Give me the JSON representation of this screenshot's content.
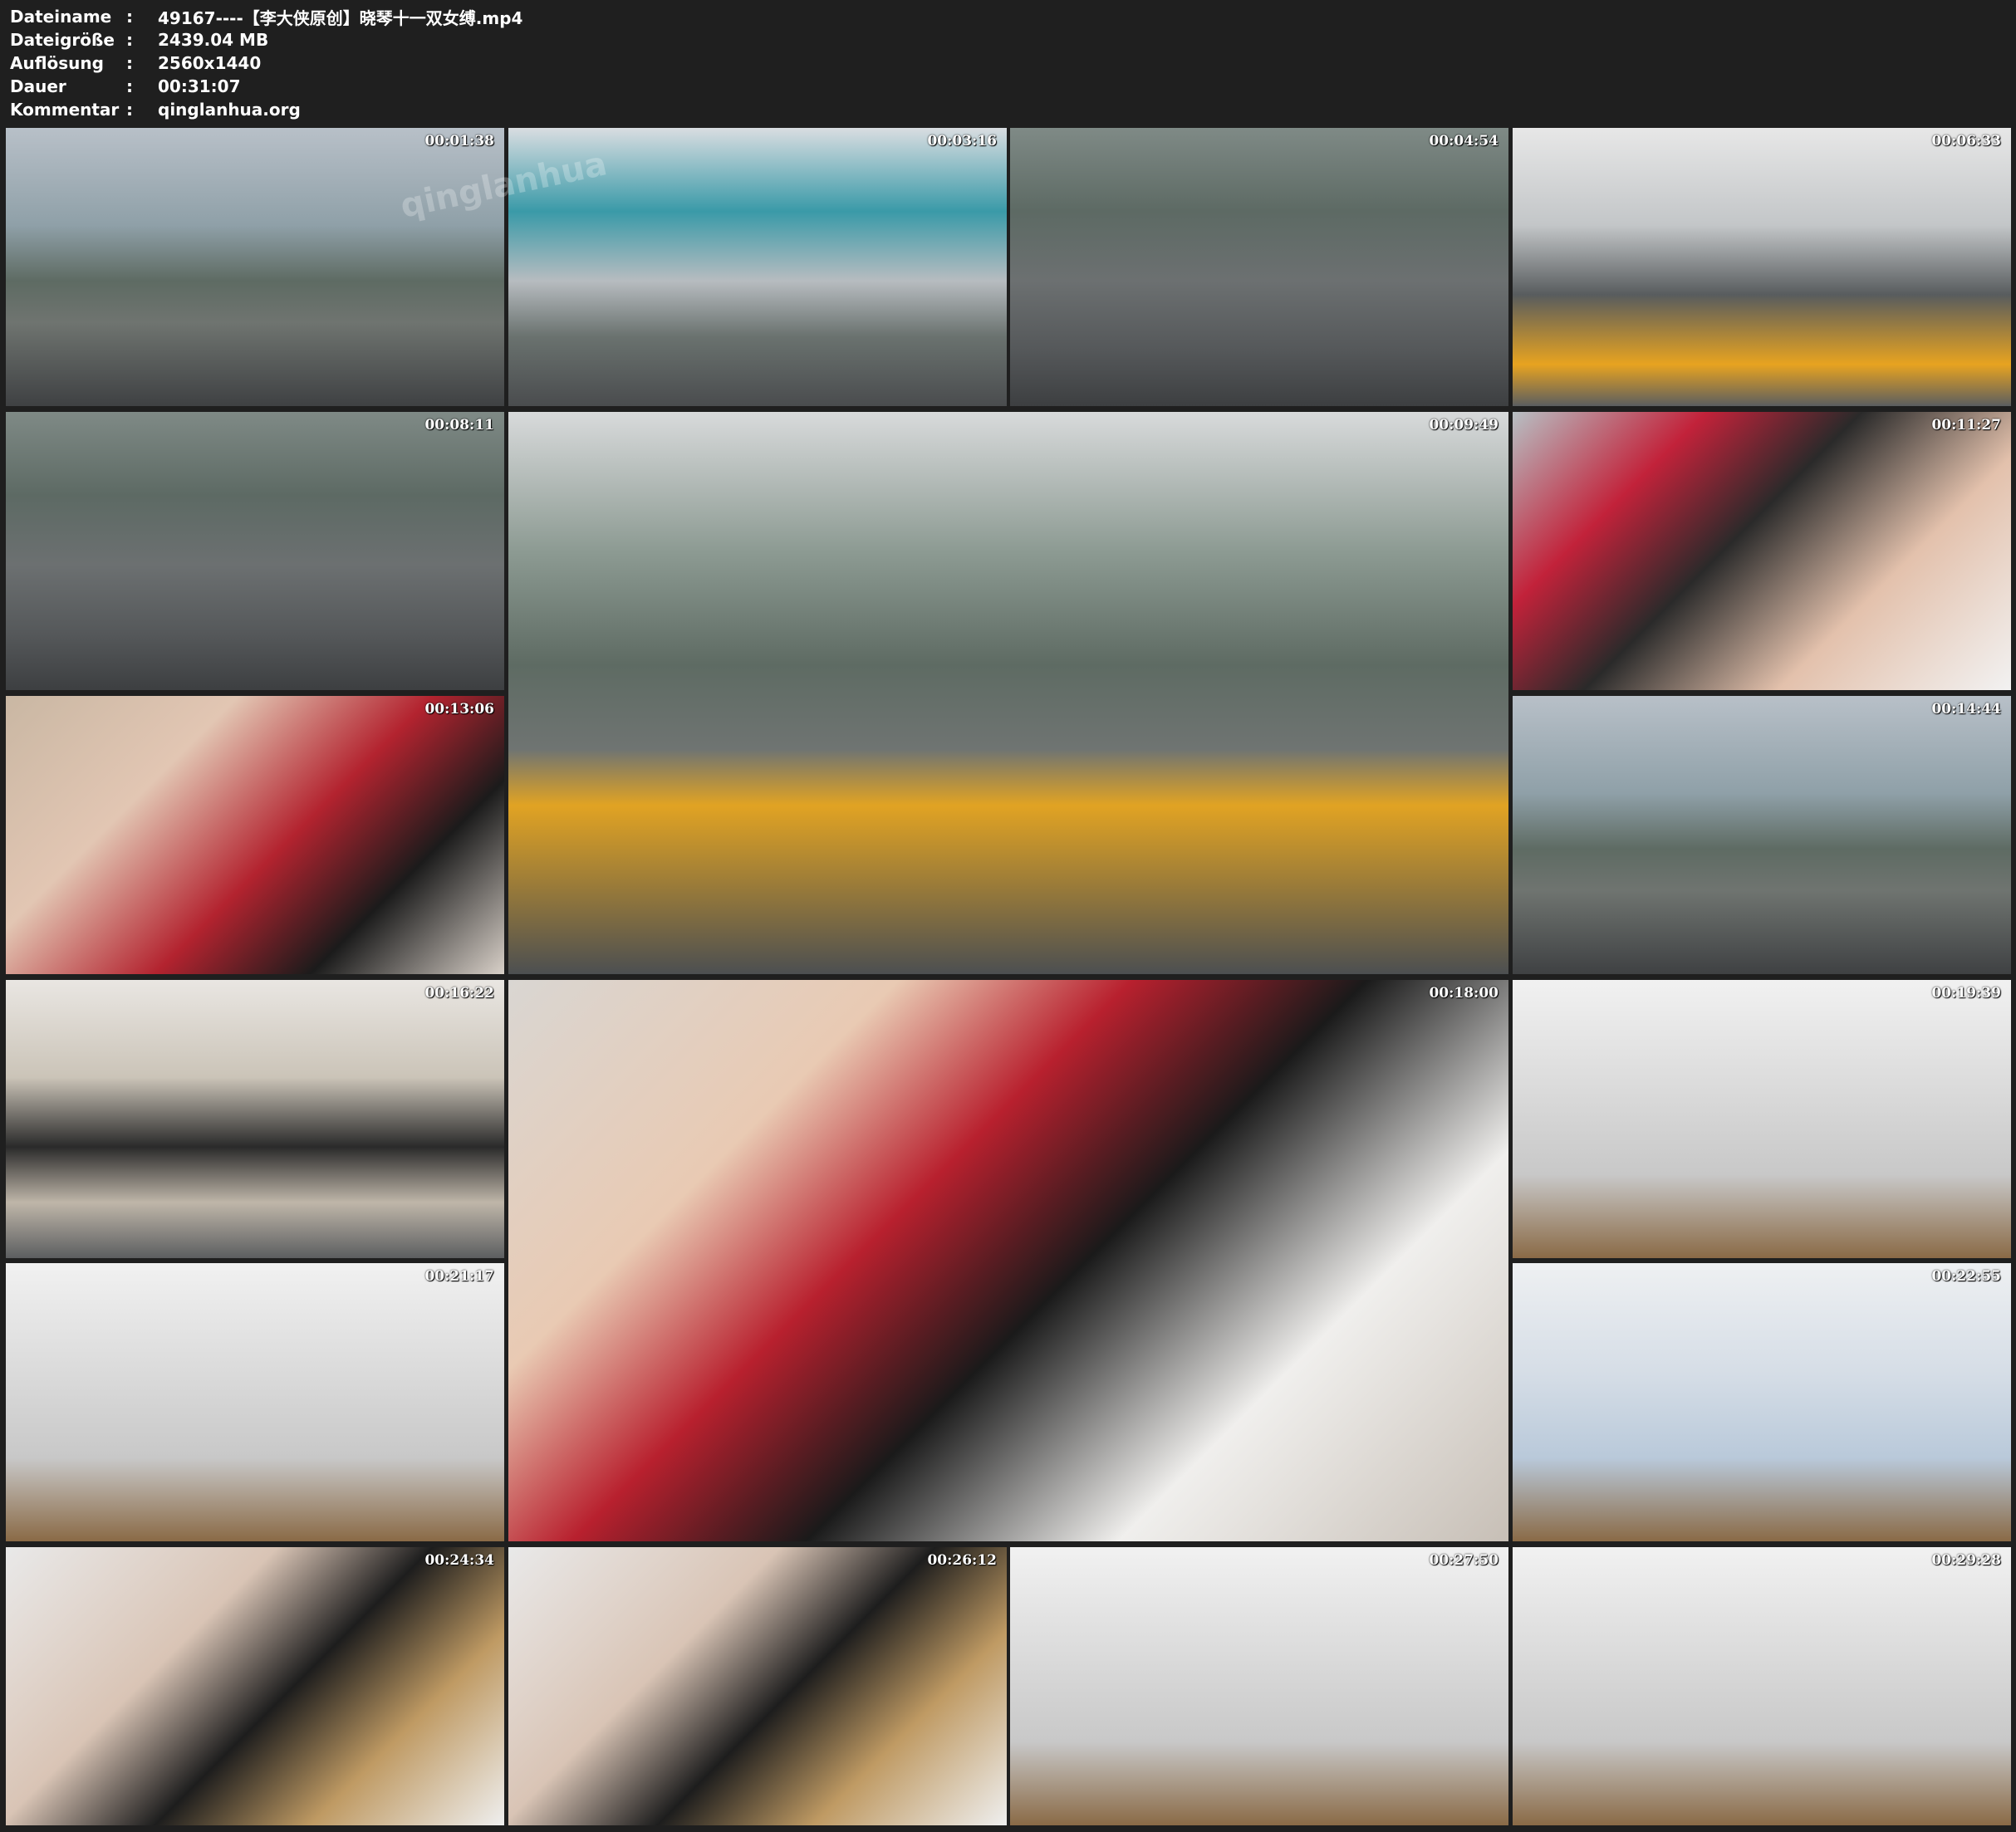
{
  "file_info": [
    {
      "label": "Dateiname",
      "sep": ":",
      "value": "49167----【李大侠原创】晓琴十一双女缚.mp4"
    },
    {
      "label": "Dateigröße",
      "sep": ":",
      "value": "2439.04 MB"
    },
    {
      "label": "Auflösung",
      "sep": ":",
      "value": "2560x1440"
    },
    {
      "label": "Dauer",
      "sep": ":",
      "value": "00:31:07"
    },
    {
      "label": "Kommentar",
      "sep": ":",
      "value": "qinglanhua.org"
    }
  ],
  "watermark": "qinglanhua",
  "thumbnails": [
    {
      "time": "00:01:38",
      "palette": "living-green"
    },
    {
      "time": "00:03:16",
      "palette": "living-teal"
    },
    {
      "time": "00:04:54",
      "palette": "floor-gray"
    },
    {
      "time": "00:06:33",
      "palette": "floor-orange"
    },
    {
      "time": "00:08:11",
      "palette": "floor-gray"
    },
    {
      "time": "00:09:49",
      "palette": "living-large"
    },
    {
      "time": "00:11:27",
      "palette": "closeup-red"
    },
    {
      "time": "00:13:06",
      "palette": "closeup-warm"
    },
    {
      "time": "00:14:44",
      "palette": "living-green"
    },
    {
      "time": "00:16:22",
      "palette": "room-warm"
    },
    {
      "time": "00:18:00",
      "palette": "closeup-large"
    },
    {
      "time": "00:19:39",
      "palette": "frame-white"
    },
    {
      "time": "00:21:17",
      "palette": "frame-white"
    },
    {
      "time": "00:22:55",
      "palette": "frame-blue"
    },
    {
      "time": "00:24:34",
      "palette": "closeup-white"
    },
    {
      "time": "00:26:12",
      "palette": "closeup-white"
    },
    {
      "time": "00:27:50",
      "palette": "frame-white"
    },
    {
      "time": "00:29:28",
      "palette": "frame-white"
    }
  ]
}
